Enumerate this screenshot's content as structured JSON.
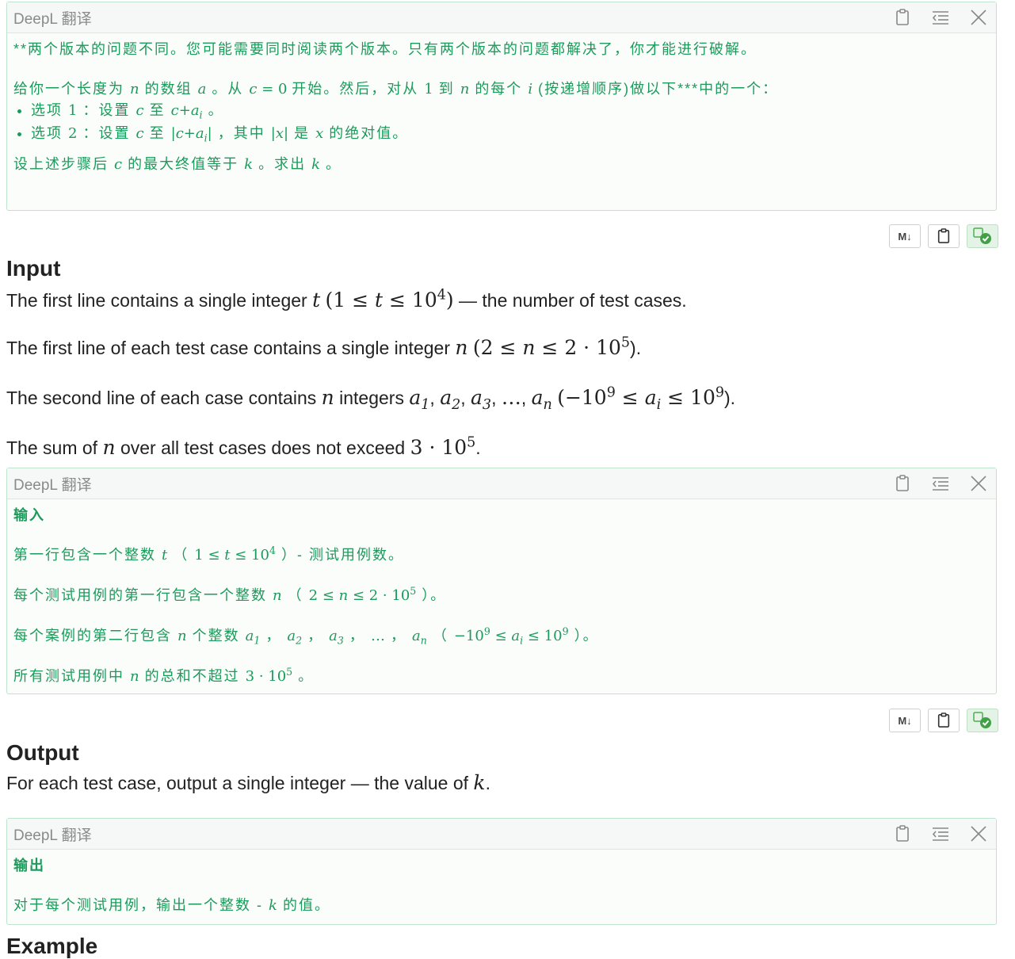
{
  "translate_box_label": "DeepL 翻译",
  "box1": {
    "p1": "**两个版本的问题不同。您可能需要同时阅读两个版本。只有两个版本的问题都解决了，你才能进行破解。",
    "p2_a": "给你一个长度为",
    "p2_b": "的数组",
    "p2_c": "。从",
    "p2_d": "开始。然后，对从",
    "p2_e": "到",
    "p2_f": "的每个",
    "p2_g": "(按递增顺序)做以下***中的一个：",
    "opt1_a": "选项",
    "opt1_b": "：设置",
    "opt1_c": "至",
    "opt2_a": "选项",
    "opt2_b": "：设置",
    "opt2_c": "至",
    "opt2_d": "，其中",
    "opt2_e": "是",
    "opt2_f": "的绝对值。",
    "p3_a": "设上述步骤后",
    "p3_b": "的最大终值等于",
    "p3_c": "。求出",
    "p3_d": "。"
  },
  "toolbar": {
    "md_label": "M↓"
  },
  "input": {
    "title": "Input",
    "l1_a": "The first line contains a single integer",
    "l1_b": "— the number of test cases.",
    "l2_a": "The first line of each test case contains a single integer",
    "l2_b": ").",
    "l3_a": "The second line of each case contains",
    "l3_b": "integers",
    "l3_c": ").",
    "l4_a": "The sum of",
    "l4_b": "over all test cases does not exceed",
    "l4_c": "."
  },
  "box2": {
    "head": "输入",
    "l1_a": "第一行包含一个整数",
    "l1_b": "（",
    "l1_c": "）- 测试用例数。",
    "l2_a": "每个测试用例的第一行包含一个整数",
    "l2_b": "（",
    "l2_c": "）。",
    "l3_a": "每个案例的第二行包含",
    "l3_b": "个整数",
    "l3_c": "（",
    "l3_d": "）。",
    "l4_a": "所有测试用例中",
    "l4_b": "的总和不超过",
    "l4_c": "。"
  },
  "output": {
    "title": "Output",
    "l1_a": "For each test case, output a single integer — the value of",
    "l1_b": "."
  },
  "box3": {
    "head": "输出",
    "l1_a": "对于每个测试用例，输出一个整数 -",
    "l1_b": "的值。"
  },
  "example_title": "Example",
  "colors": {
    "translation_text": "#1c9a5b",
    "box_border": "#bfe3cf"
  },
  "icons": [
    "clipboard-icon",
    "indent-icon",
    "close-icon",
    "markdown-icon",
    "translate-check-icon"
  ]
}
